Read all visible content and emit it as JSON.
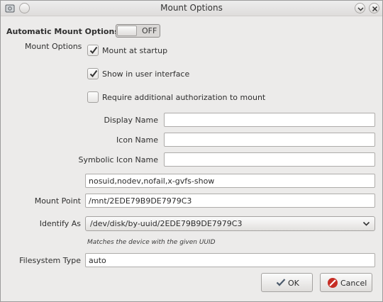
{
  "window": {
    "title": "Mount Options"
  },
  "automatic": {
    "label": "Automatic Mount Options",
    "toggle_state": "OFF"
  },
  "mount_options": {
    "label": "Mount Options",
    "checkboxes": [
      {
        "label": "Mount at startup",
        "checked": true
      },
      {
        "label": "Show in user interface",
        "checked": true
      },
      {
        "label": "Require additional authorization to mount",
        "checked": false
      }
    ]
  },
  "fields": {
    "display_name": {
      "label": "Display Name",
      "value": ""
    },
    "icon_name": {
      "label": "Icon Name",
      "value": ""
    },
    "symbolic_icon_name": {
      "label": "Symbolic Icon Name",
      "value": ""
    },
    "options": {
      "value": "nosuid,nodev,nofail,x-gvfs-show"
    },
    "mount_point": {
      "label": "Mount Point",
      "value": "/mnt/2EDE79B9DE7979C3"
    },
    "identify_as": {
      "label": "Identify As",
      "value": "/dev/disk/by-uuid/2EDE79B9DE7979C3",
      "hint": "Matches the device with the given UUID"
    },
    "filesystem_type": {
      "label": "Filesystem Type",
      "value": "auto"
    }
  },
  "buttons": {
    "ok": "OK",
    "cancel": "Cancel"
  },
  "icons": {
    "app": "disk-icon",
    "minimize": "chevron-down-icon",
    "close": "close-icon",
    "ok": "checkmark-icon",
    "cancel": "cancel-icon"
  },
  "colors": {
    "cancel_red": "#c62d24",
    "ok_check": "#4b5a6b"
  }
}
